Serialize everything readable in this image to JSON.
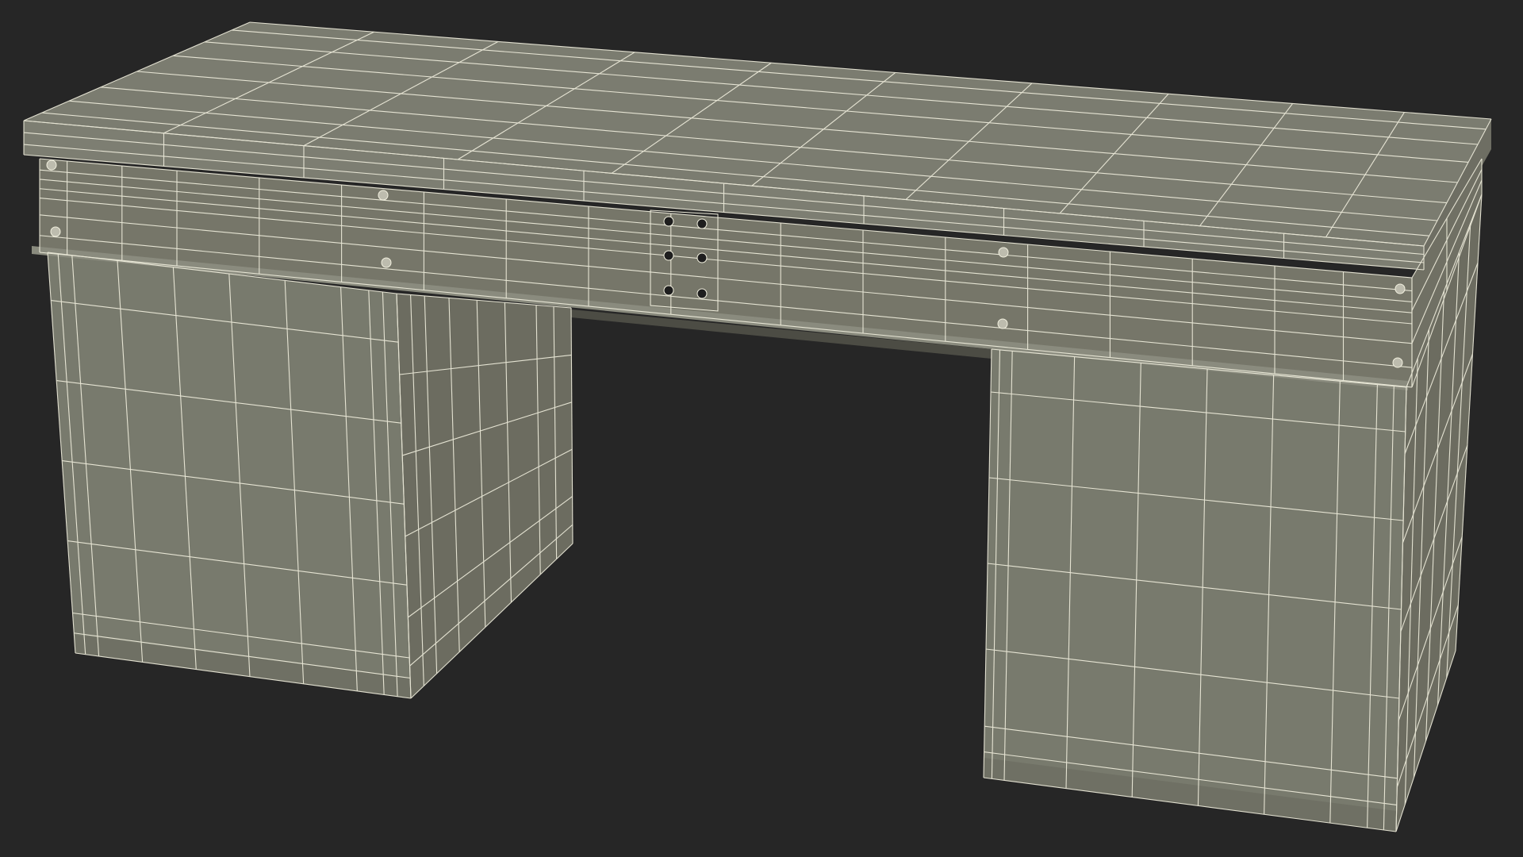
{
  "scene": {
    "subject": "desk-wireframe",
    "render_style": "wireframe-over-shaded",
    "colors": {
      "background": "#262626",
      "top_face": "#7b7c70",
      "front_face": "#767669",
      "pedestal_front": "#787a6d",
      "pedestal_side": "#6c6c60",
      "side_face": "#717165",
      "underside": "#5f5f55",
      "wire": "#f2f0df",
      "screw": "#bdbcae",
      "handle_hole": "#1e1e1e"
    }
  }
}
